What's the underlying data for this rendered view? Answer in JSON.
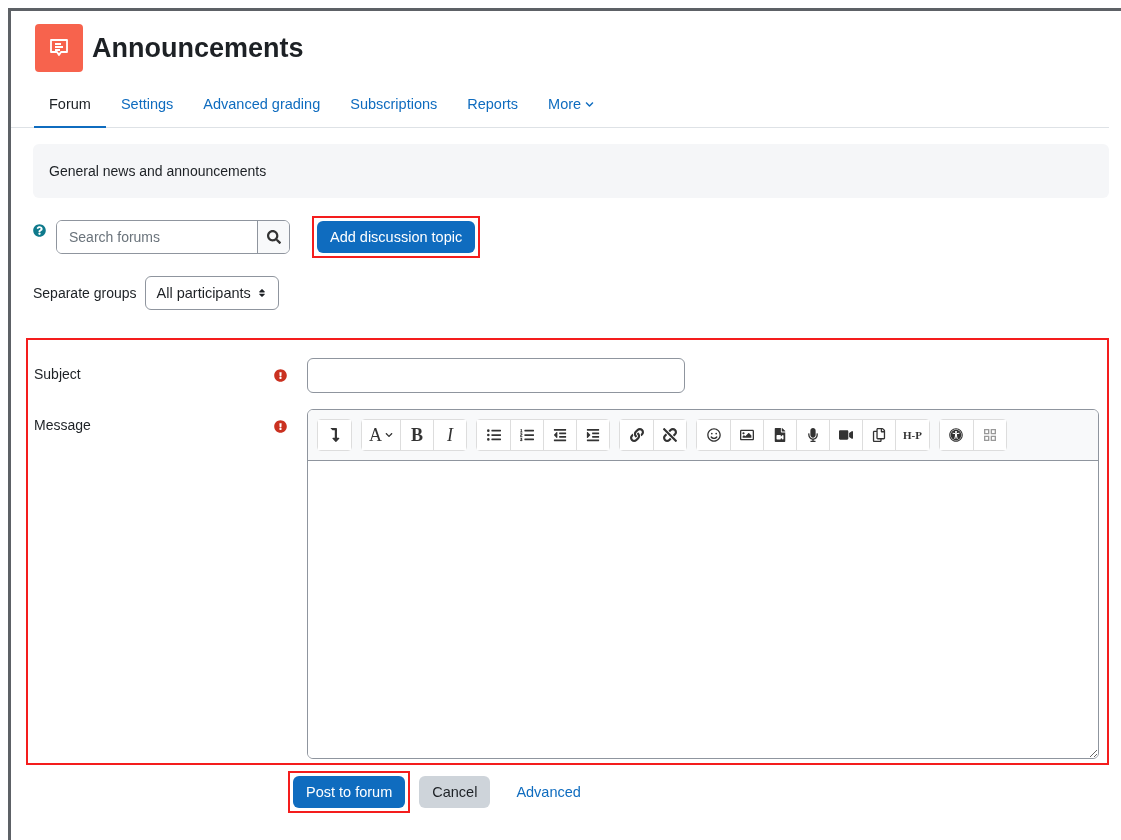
{
  "header": {
    "title": "Announcements"
  },
  "tabs": [
    {
      "label": "Forum",
      "selected": true
    },
    {
      "label": "Settings",
      "selected": false
    },
    {
      "label": "Advanced grading",
      "selected": false
    },
    {
      "label": "Subscriptions",
      "selected": false
    },
    {
      "label": "Reports",
      "selected": false
    },
    {
      "label": "More",
      "selected": false,
      "dropdown": true
    }
  ],
  "description": "General news and announcements",
  "search": {
    "placeholder": "Search forums"
  },
  "add_button": {
    "label": "Add discussion topic",
    "highlighted": true
  },
  "group_filter": {
    "label": "Separate groups",
    "value": "All participants"
  },
  "form": {
    "highlighted": true,
    "subject": {
      "label": "Subject",
      "required": true
    },
    "message": {
      "label": "Message",
      "required": true
    },
    "toolbar": [
      {
        "buttons": [
          {
            "kind": "collapse"
          }
        ]
      },
      {
        "buttons": [
          {
            "kind": "glyph",
            "label": "A",
            "caret": true
          },
          {
            "kind": "bold-glyph",
            "label": "B"
          },
          {
            "kind": "italic-glyph",
            "label": "I"
          }
        ]
      },
      {
        "buttons": [
          {
            "kind": "bullets"
          },
          {
            "kind": "numbers"
          },
          {
            "kind": "outdent"
          },
          {
            "kind": "indent"
          }
        ]
      },
      {
        "buttons": [
          {
            "kind": "link"
          },
          {
            "kind": "unlink"
          }
        ]
      },
      {
        "buttons": [
          {
            "kind": "emoji"
          },
          {
            "kind": "image"
          },
          {
            "kind": "media"
          },
          {
            "kind": "audio"
          },
          {
            "kind": "video"
          },
          {
            "kind": "copy"
          },
          {
            "kind": "bold-glyph",
            "label": "H-P"
          }
        ]
      },
      {
        "buttons": [
          {
            "kind": "accessibility"
          },
          {
            "kind": "braille"
          }
        ]
      }
    ]
  },
  "actions": [
    {
      "label": "Post to forum",
      "kind": "primary",
      "highlighted": true
    },
    {
      "label": "Cancel",
      "kind": "secondary",
      "highlighted": false
    },
    {
      "label": "Advanced",
      "kind": "link",
      "highlighted": false
    }
  ]
}
